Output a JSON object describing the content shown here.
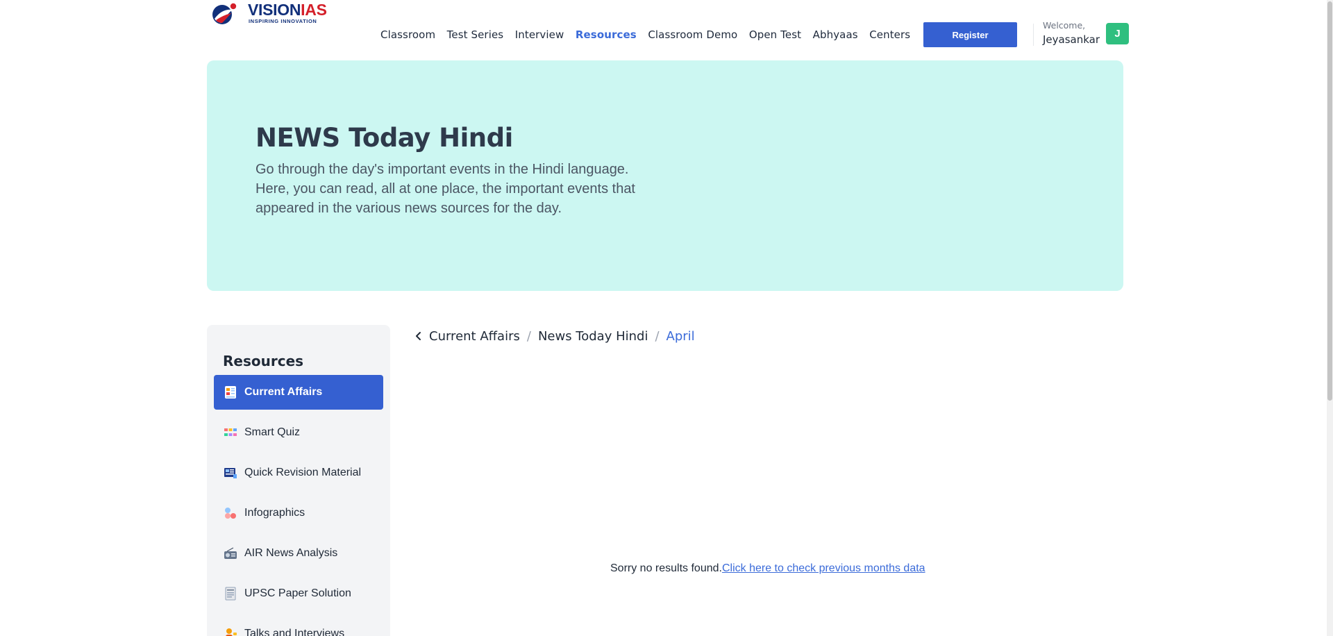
{
  "brand": {
    "name_part1": "VISION",
    "name_part2": "IAS",
    "tagline": "INSPIRING INNOVATION",
    "colors": {
      "primary": "#12307a",
      "accent": "#d4202a"
    }
  },
  "nav": {
    "items": [
      {
        "label": "Classroom",
        "active": false
      },
      {
        "label": "Test Series",
        "active": false
      },
      {
        "label": "Interview",
        "active": false
      },
      {
        "label": "Resources",
        "active": true
      },
      {
        "label": "Classroom Demo",
        "active": false
      },
      {
        "label": "Open Test",
        "active": false
      },
      {
        "label": "Abhyaas",
        "active": false
      },
      {
        "label": "Centers",
        "active": false
      }
    ],
    "register_label": "Register"
  },
  "user": {
    "welcome": "Welcome,",
    "name": "Jeyasankar",
    "avatar_initial": "J"
  },
  "hero": {
    "title": "NEWS Today Hindi",
    "description": "Go through the day's important events in the Hindi language. Here, you can read, all at one place, the important events that appeared in the various news sources for the day.",
    "background": "#ccf7f2"
  },
  "sidebar": {
    "title": "Resources",
    "items": [
      {
        "label": "Current Affairs",
        "icon": "current-affairs-icon",
        "active": true
      },
      {
        "label": "Smart Quiz",
        "icon": "smart-quiz-icon",
        "active": false
      },
      {
        "label": "Quick Revision Material",
        "icon": "revision-icon",
        "active": false
      },
      {
        "label": "Infographics",
        "icon": "infographics-icon",
        "active": false
      },
      {
        "label": "AIR News Analysis",
        "icon": "radio-icon",
        "active": false
      },
      {
        "label": "UPSC Paper Solution",
        "icon": "paper-icon",
        "active": false
      },
      {
        "label": "Talks and Interviews",
        "icon": "talks-icon",
        "active": false
      }
    ]
  },
  "breadcrumb": {
    "items": [
      "Current Affairs",
      "News Today Hindi"
    ],
    "current": "April",
    "separator": "/"
  },
  "results": {
    "empty_message": "Sorry no results found.",
    "previous_link": "Click here to check previous months data"
  },
  "colors": {
    "accent_blue": "#3560d1",
    "link_blue": "#3b6bd9",
    "avatar_green": "#2fbf7f"
  }
}
